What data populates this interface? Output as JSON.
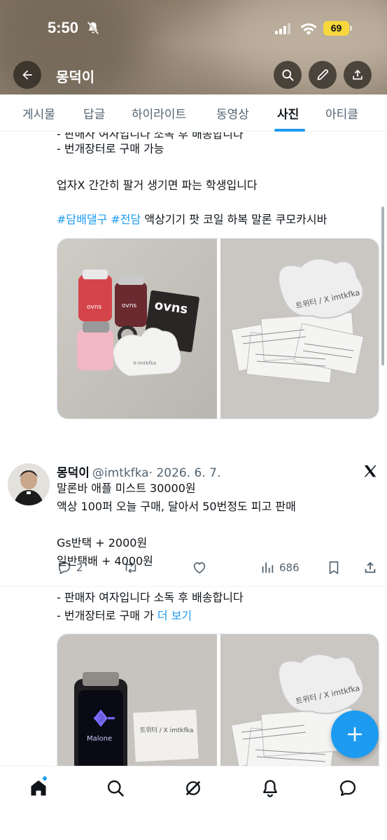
{
  "status_bar": {
    "time": "5:50",
    "battery": "69"
  },
  "header": {
    "title": "몽덕이"
  },
  "tabs": [
    {
      "label": "게시물"
    },
    {
      "label": "답글"
    },
    {
      "label": "하이라이트"
    },
    {
      "label": "동영상"
    },
    {
      "label": "사진"
    },
    {
      "label": "아티클"
    }
  ],
  "post1": {
    "partial_line": "- 판매자 여자입니다 소독 후 배송합니다",
    "line_market": "- 번개장터로 구매 가능",
    "line_student": "업자X 간간히 팔거 생기면 파는 학생입니다",
    "hashtag1": "#담배댈구",
    "hashtag2": "#전담",
    "tags_rest": "액상기기 팟 코일 하복 말론 쿠모카시바",
    "replies": "2",
    "views": "686",
    "photo_left_label": "ovns",
    "photo_right_label": "트위터 / X imtkfka"
  },
  "post2": {
    "name": "몽덕이",
    "handle": "@imtkfka",
    "date": "· 2026. 6. 7.",
    "line1": "말론바 애플 미스트 30000원",
    "line2": "액상 100퍼 오늘 구매, 달아서 50번정도 피고 판매",
    "line3": "Gs반택 + 2000원",
    "line4": "일반택배 + 4000원",
    "line5": "- 판매자 여자입니다 소독 후 배송합니다",
    "line6": "- 번개장터로 구매 가",
    "more": "더 보기",
    "photo_left_label": "Malone",
    "photo_left_note": "트위터 / X imtkfka",
    "photo_right_label": "트위터 / X imtkfka"
  },
  "colors": {
    "accent": "#1d9bf0",
    "text": "#0f1419",
    "muted": "#536471"
  }
}
